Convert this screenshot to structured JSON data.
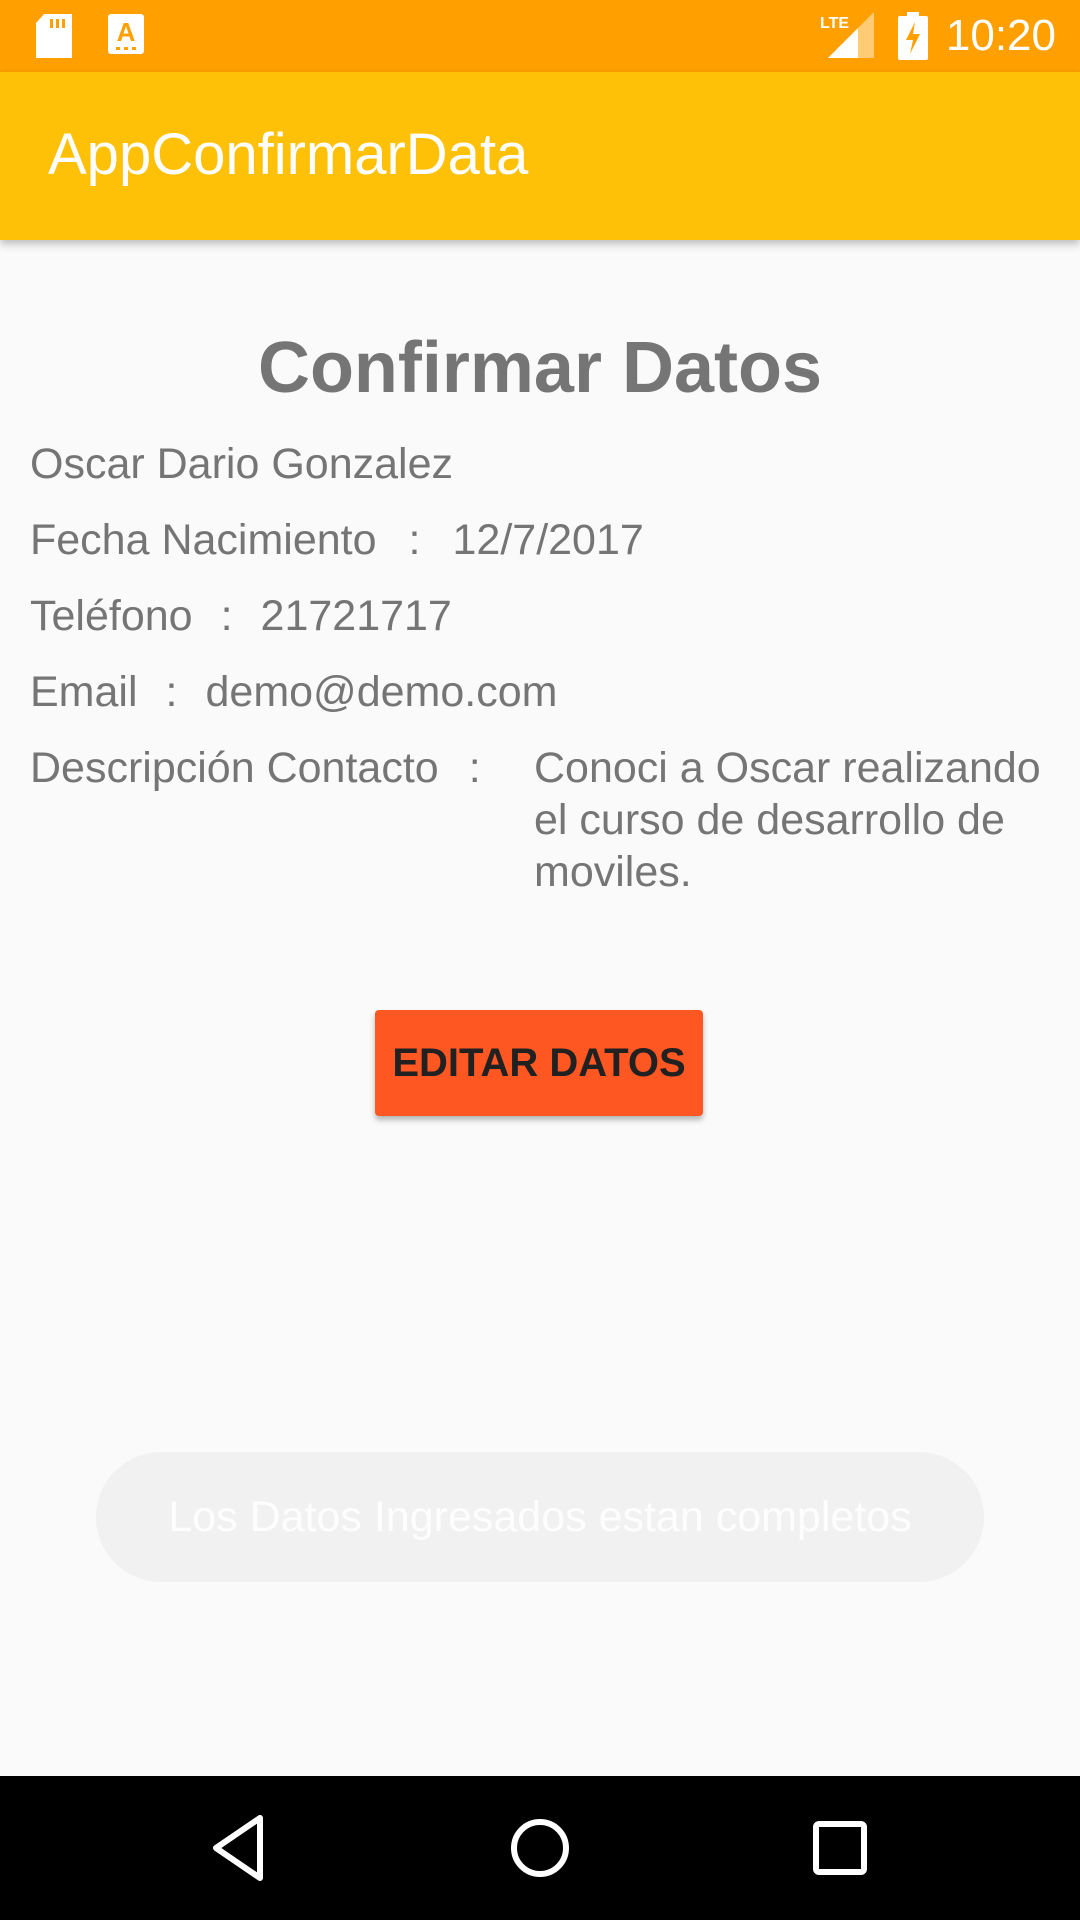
{
  "status_bar": {
    "time": "10:20",
    "icons": [
      "sd-card-icon",
      "app-notification-icon",
      "lte-signal-icon",
      "battery-charging-icon"
    ],
    "network_label": "LTE",
    "background_color": "#FFA000"
  },
  "app_bar": {
    "title": "AppConfirmarData",
    "background_color": "#FFC107"
  },
  "main": {
    "heading": "Confirmar Datos",
    "name": "Oscar Dario Gonzalez",
    "separator": ":",
    "fields": {
      "birth_date": {
        "label": "Fecha Nacimiento",
        "value": "12/7/2017"
      },
      "phone": {
        "label": "Teléfono",
        "value": "21721717"
      },
      "email": {
        "label": "Email",
        "value": "demo@demo.com"
      },
      "description": {
        "label": "Descripción Contacto",
        "value": "Conoci a Oscar realizando el curso de desarrollo de moviles."
      }
    },
    "edit_button_label": "EDITAR DATOS",
    "accent_color": "#FF5722"
  },
  "toast": {
    "message": "Los Datos Ingresados estan completos"
  },
  "nav_bar": {
    "icons": [
      "back-icon",
      "home-icon",
      "recents-icon"
    ]
  }
}
